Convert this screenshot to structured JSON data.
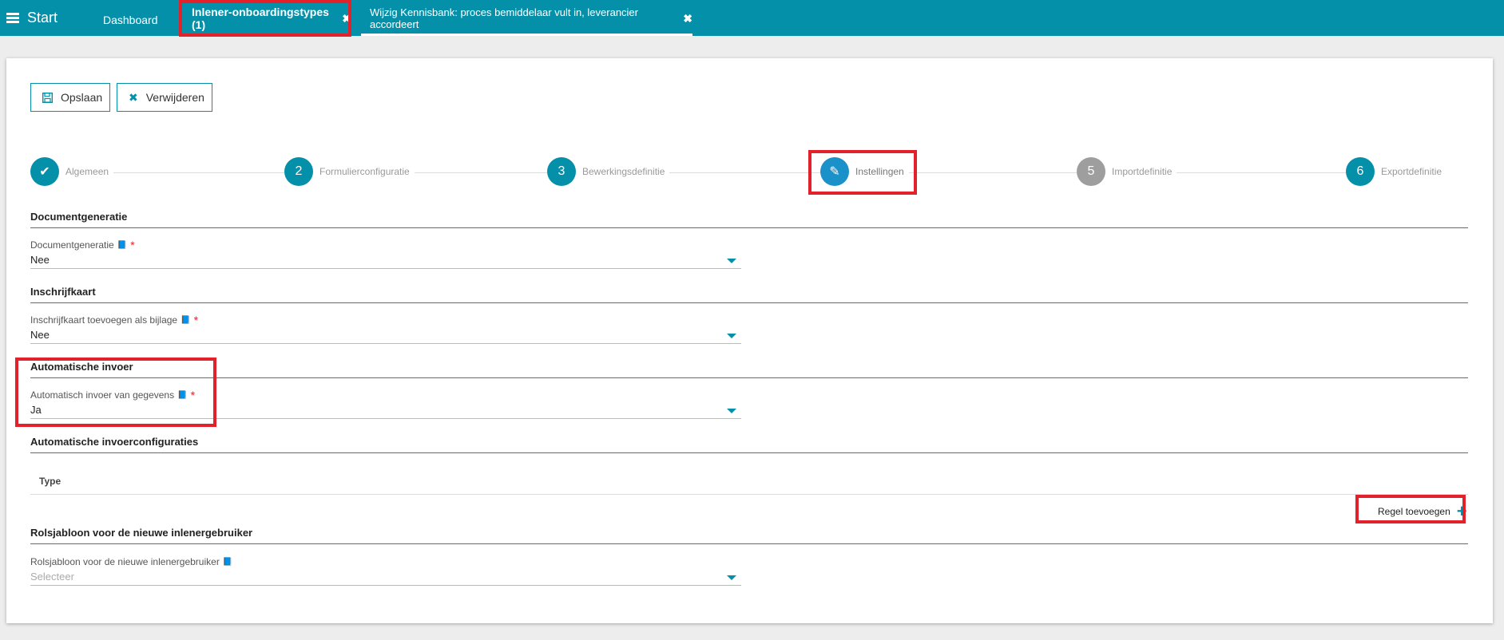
{
  "topbar": {
    "start_label": "Start",
    "tabs": [
      {
        "label": "Dashboard"
      },
      {
        "label": "Inlener-onboardingstypes (1)",
        "close": "✖"
      },
      {
        "label": "Wijzig Kennisbank: proces bemiddelaar vult in, leverancier accordeert",
        "close": "✖"
      }
    ]
  },
  "toolbar": {
    "save_label": "Opslaan",
    "delete_label": "Verwijderen"
  },
  "steps": [
    {
      "marker": "✔",
      "label": "Algemeen",
      "state": "done"
    },
    {
      "marker": "2",
      "label": "Formulierconfiguratie",
      "state": "todo"
    },
    {
      "marker": "3",
      "label": "Bewerkingsdefinitie",
      "state": "todo"
    },
    {
      "marker": "✎",
      "label": "Instellingen",
      "state": "active"
    },
    {
      "marker": "5",
      "label": "Importdefinitie",
      "state": "disabled"
    },
    {
      "marker": "6",
      "label": "Exportdefinitie",
      "state": "todo"
    }
  ],
  "sections": {
    "docgen": {
      "title": "Documentgeneratie",
      "field_label": "Documentgeneratie",
      "value": "Nee"
    },
    "inschrijf": {
      "title": "Inschrijfkaart",
      "field_label": "Inschrijfkaart toevoegen als bijlage",
      "value": "Nee"
    },
    "autoinvoer": {
      "title": "Automatische invoer",
      "field_label": "Automatisch invoer van gegevens",
      "value": "Ja"
    },
    "autoconfig": {
      "title": "Automatische invoerconfiguraties",
      "column_type": "Type",
      "add_label": "Regel toevoegen"
    },
    "rol": {
      "title": "Rolsjabloon voor de nieuwe inlenergebruiker",
      "field_label": "Rolsjabloon voor de nieuwe inlenergebruiker",
      "placeholder": "Selecteer"
    }
  },
  "required_marker": "*",
  "colors": {
    "primary": "#0590a9",
    "highlight": "#e3212b",
    "active_step": "#1a91c9",
    "disabled_step": "#9e9e9e"
  }
}
